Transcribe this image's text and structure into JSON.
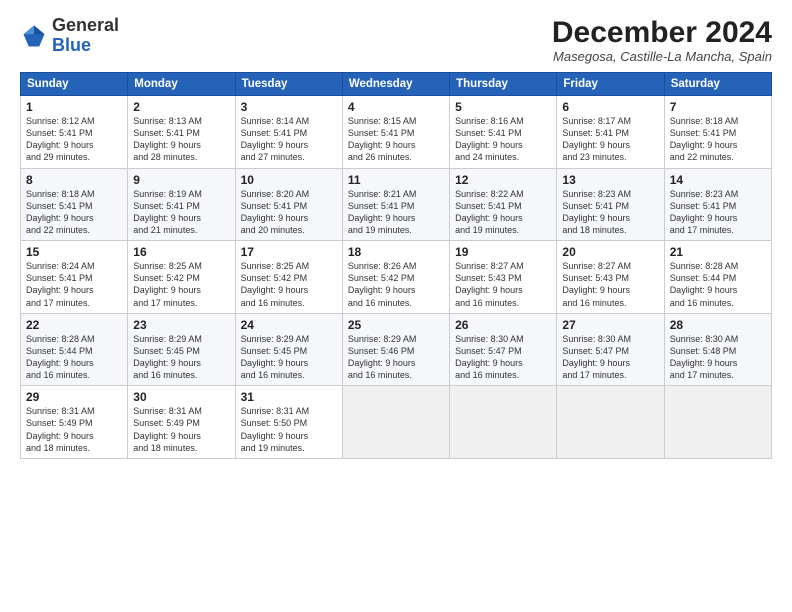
{
  "header": {
    "logo_general": "General",
    "logo_blue": "Blue",
    "month_title": "December 2024",
    "subtitle": "Masegosa, Castille-La Mancha, Spain"
  },
  "weekdays": [
    "Sunday",
    "Monday",
    "Tuesday",
    "Wednesday",
    "Thursday",
    "Friday",
    "Saturday"
  ],
  "weeks": [
    [
      {
        "day": "1",
        "info": "Sunrise: 8:12 AM\nSunset: 5:41 PM\nDaylight: 9 hours\nand 29 minutes."
      },
      {
        "day": "2",
        "info": "Sunrise: 8:13 AM\nSunset: 5:41 PM\nDaylight: 9 hours\nand 28 minutes."
      },
      {
        "day": "3",
        "info": "Sunrise: 8:14 AM\nSunset: 5:41 PM\nDaylight: 9 hours\nand 27 minutes."
      },
      {
        "day": "4",
        "info": "Sunrise: 8:15 AM\nSunset: 5:41 PM\nDaylight: 9 hours\nand 26 minutes."
      },
      {
        "day": "5",
        "info": "Sunrise: 8:16 AM\nSunset: 5:41 PM\nDaylight: 9 hours\nand 24 minutes."
      },
      {
        "day": "6",
        "info": "Sunrise: 8:17 AM\nSunset: 5:41 PM\nDaylight: 9 hours\nand 23 minutes."
      },
      {
        "day": "7",
        "info": "Sunrise: 8:18 AM\nSunset: 5:41 PM\nDaylight: 9 hours\nand 22 minutes."
      }
    ],
    [
      {
        "day": "8",
        "info": "Sunrise: 8:18 AM\nSunset: 5:41 PM\nDaylight: 9 hours\nand 22 minutes."
      },
      {
        "day": "9",
        "info": "Sunrise: 8:19 AM\nSunset: 5:41 PM\nDaylight: 9 hours\nand 21 minutes."
      },
      {
        "day": "10",
        "info": "Sunrise: 8:20 AM\nSunset: 5:41 PM\nDaylight: 9 hours\nand 20 minutes."
      },
      {
        "day": "11",
        "info": "Sunrise: 8:21 AM\nSunset: 5:41 PM\nDaylight: 9 hours\nand 19 minutes."
      },
      {
        "day": "12",
        "info": "Sunrise: 8:22 AM\nSunset: 5:41 PM\nDaylight: 9 hours\nand 19 minutes."
      },
      {
        "day": "13",
        "info": "Sunrise: 8:23 AM\nSunset: 5:41 PM\nDaylight: 9 hours\nand 18 minutes."
      },
      {
        "day": "14",
        "info": "Sunrise: 8:23 AM\nSunset: 5:41 PM\nDaylight: 9 hours\nand 17 minutes."
      }
    ],
    [
      {
        "day": "15",
        "info": "Sunrise: 8:24 AM\nSunset: 5:41 PM\nDaylight: 9 hours\nand 17 minutes."
      },
      {
        "day": "16",
        "info": "Sunrise: 8:25 AM\nSunset: 5:42 PM\nDaylight: 9 hours\nand 17 minutes."
      },
      {
        "day": "17",
        "info": "Sunrise: 8:25 AM\nSunset: 5:42 PM\nDaylight: 9 hours\nand 16 minutes."
      },
      {
        "day": "18",
        "info": "Sunrise: 8:26 AM\nSunset: 5:42 PM\nDaylight: 9 hours\nand 16 minutes."
      },
      {
        "day": "19",
        "info": "Sunrise: 8:27 AM\nSunset: 5:43 PM\nDaylight: 9 hours\nand 16 minutes."
      },
      {
        "day": "20",
        "info": "Sunrise: 8:27 AM\nSunset: 5:43 PM\nDaylight: 9 hours\nand 16 minutes."
      },
      {
        "day": "21",
        "info": "Sunrise: 8:28 AM\nSunset: 5:44 PM\nDaylight: 9 hours\nand 16 minutes."
      }
    ],
    [
      {
        "day": "22",
        "info": "Sunrise: 8:28 AM\nSunset: 5:44 PM\nDaylight: 9 hours\nand 16 minutes."
      },
      {
        "day": "23",
        "info": "Sunrise: 8:29 AM\nSunset: 5:45 PM\nDaylight: 9 hours\nand 16 minutes."
      },
      {
        "day": "24",
        "info": "Sunrise: 8:29 AM\nSunset: 5:45 PM\nDaylight: 9 hours\nand 16 minutes."
      },
      {
        "day": "25",
        "info": "Sunrise: 8:29 AM\nSunset: 5:46 PM\nDaylight: 9 hours\nand 16 minutes."
      },
      {
        "day": "26",
        "info": "Sunrise: 8:30 AM\nSunset: 5:47 PM\nDaylight: 9 hours\nand 16 minutes."
      },
      {
        "day": "27",
        "info": "Sunrise: 8:30 AM\nSunset: 5:47 PM\nDaylight: 9 hours\nand 17 minutes."
      },
      {
        "day": "28",
        "info": "Sunrise: 8:30 AM\nSunset: 5:48 PM\nDaylight: 9 hours\nand 17 minutes."
      }
    ],
    [
      {
        "day": "29",
        "info": "Sunrise: 8:31 AM\nSunset: 5:49 PM\nDaylight: 9 hours\nand 18 minutes."
      },
      {
        "day": "30",
        "info": "Sunrise: 8:31 AM\nSunset: 5:49 PM\nDaylight: 9 hours\nand 18 minutes."
      },
      {
        "day": "31",
        "info": "Sunrise: 8:31 AM\nSunset: 5:50 PM\nDaylight: 9 hours\nand 19 minutes."
      },
      {
        "day": "",
        "info": ""
      },
      {
        "day": "",
        "info": ""
      },
      {
        "day": "",
        "info": ""
      },
      {
        "day": "",
        "info": ""
      }
    ]
  ]
}
